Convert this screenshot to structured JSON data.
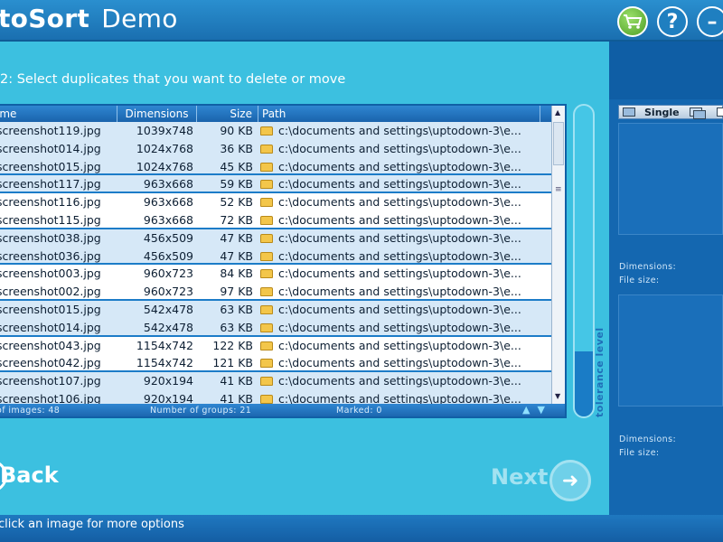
{
  "window": {
    "title_name": "toSort",
    "title_demo": "Demo",
    "buttons": {
      "cart_icon": "cart-icon",
      "help_label": "?",
      "minimize_label": "–"
    }
  },
  "step": {
    "label": "2:  Select duplicates that you want to delete or move"
  },
  "table": {
    "headers": {
      "name": "ame",
      "dimensions": "Dimensions",
      "size": "Size",
      "path": "Path"
    },
    "rows": [
      {
        "name": "screenshot119.jpg",
        "dim": "1039x748",
        "size": "90 KB",
        "path": "c:\\documents and settings\\uptodown-3\\e..."
      },
      {
        "name": "screenshot014.jpg",
        "dim": "1024x768",
        "size": "36 KB",
        "path": "c:\\documents and settings\\uptodown-3\\e..."
      },
      {
        "name": "screenshot015.jpg",
        "dim": "1024x768",
        "size": "45 KB",
        "path": "c:\\documents and settings\\uptodown-3\\e..."
      },
      {
        "name": "screenshot117.jpg",
        "dim": "963x668",
        "size": "59 KB",
        "path": "c:\\documents and settings\\uptodown-3\\e..."
      },
      {
        "name": "screenshot116.jpg",
        "dim": "963x668",
        "size": "52 KB",
        "path": "c:\\documents and settings\\uptodown-3\\e..."
      },
      {
        "name": "screenshot115.jpg",
        "dim": "963x668",
        "size": "72 KB",
        "path": "c:\\documents and settings\\uptodown-3\\e..."
      },
      {
        "name": "screenshot038.jpg",
        "dim": "456x509",
        "size": "47 KB",
        "path": "c:\\documents and settings\\uptodown-3\\e..."
      },
      {
        "name": "screenshot036.jpg",
        "dim": "456x509",
        "size": "47 KB",
        "path": "c:\\documents and settings\\uptodown-3\\e..."
      },
      {
        "name": "screenshot003.jpg",
        "dim": "960x723",
        "size": "84 KB",
        "path": "c:\\documents and settings\\uptodown-3\\e..."
      },
      {
        "name": "screenshot002.jpg",
        "dim": "960x723",
        "size": "97 KB",
        "path": "c:\\documents and settings\\uptodown-3\\e..."
      },
      {
        "name": "screenshot015.jpg",
        "dim": "542x478",
        "size": "63 KB",
        "path": "c:\\documents and settings\\uptodown-3\\e..."
      },
      {
        "name": "screenshot014.jpg",
        "dim": "542x478",
        "size": "63 KB",
        "path": "c:\\documents and settings\\uptodown-3\\e..."
      },
      {
        "name": "screenshot043.jpg",
        "dim": "1154x742",
        "size": "122 KB",
        "path": "c:\\documents and settings\\uptodown-3\\e..."
      },
      {
        "name": "screenshot042.jpg",
        "dim": "1154x742",
        "size": "121 KB",
        "path": "c:\\documents and settings\\uptodown-3\\e..."
      },
      {
        "name": "screenshot107.jpg",
        "dim": "920x194",
        "size": "41 KB",
        "path": "c:\\documents and settings\\uptodown-3\\e..."
      },
      {
        "name": "screenshot106.jpg",
        "dim": "920x194",
        "size": "41 KB",
        "path": "c:\\documents and settings\\uptodown-3\\e..."
      }
    ],
    "footer": {
      "images": "of images: 48",
      "groups": "Number of groups: 21",
      "marked": "Marked: 0",
      "arrows": "▲▼"
    }
  },
  "tolerance": {
    "label": "tolerance level",
    "level_fraction": 0.21
  },
  "right_panel": {
    "tab_single": "Single",
    "info1": {
      "dimensions": "Dimensions:",
      "file_size": "File size:"
    },
    "info2": {
      "dimensions": "Dimensions:",
      "file_size": "File size:"
    }
  },
  "nav": {
    "back": "Back",
    "next": "Next"
  },
  "status": {
    "text": "click an image for more options"
  },
  "colors": {
    "accent": "#3cc0e0",
    "dark_blue": "#1467b0",
    "row_alt": "#d6e8f7"
  }
}
